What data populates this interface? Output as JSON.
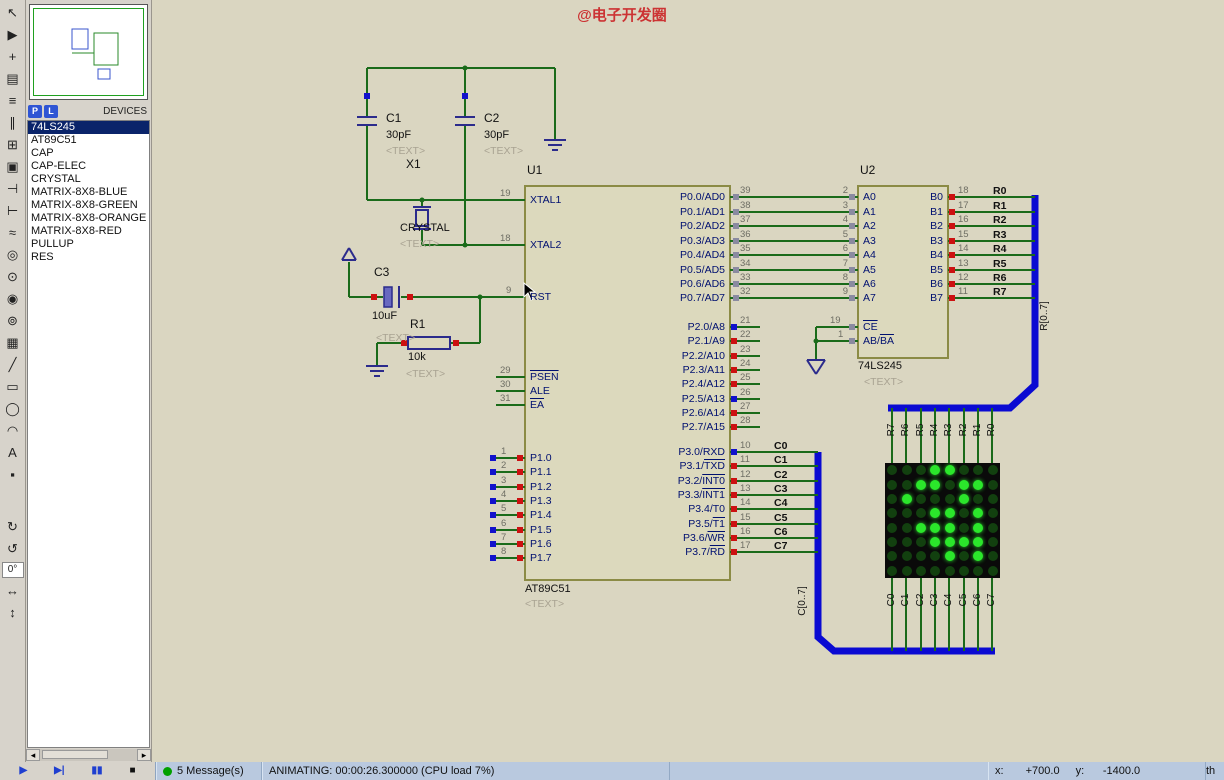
{
  "palette": {
    "canvas_bg": "#dad6c1",
    "wire": "#1a6b1a",
    "bus": "#0a0ad2",
    "chip_fill": "#dcd9bd",
    "chip_border": "#8b8b45",
    "symbol": "#2b2b8c",
    "pin_name": "#001070",
    "pin_num": "#6e6e64",
    "placeholder": "#a9a392",
    "title": "#cc3333",
    "indicator_high": "#cc1111",
    "indicator_low": "#1111cc",
    "indicator_float": "#8a8aa0",
    "matrix_bg": "#0a0a0a",
    "matrix_on": "#2be62b",
    "matrix_off": "#12400f",
    "selection_bg": "#0a246a"
  },
  "toolbar": {
    "icons": [
      {
        "name": "selection-tool",
        "glyph": "↖"
      },
      {
        "name": "component-mode",
        "glyph": "▶"
      },
      {
        "name": "junction-dot-mode",
        "glyph": "+"
      },
      {
        "name": "wire-label-mode",
        "glyph": "▤"
      },
      {
        "name": "text-script-mode",
        "glyph": "≡"
      },
      {
        "name": "buses-mode",
        "glyph": "∥"
      },
      {
        "name": "subcircuit-mode",
        "glyph": "⊞"
      },
      {
        "name": "instant-edit-mode",
        "glyph": "▣"
      },
      {
        "name": "inter-sheet-terminal-mode",
        "glyph": "⊣"
      },
      {
        "name": "device-pins-mode",
        "glyph": "⊢"
      },
      {
        "name": "graph-mode",
        "glyph": "≈"
      },
      {
        "name": "tape-recorder-mode",
        "glyph": "◎"
      },
      {
        "name": "generator-mode",
        "glyph": "⊙"
      },
      {
        "name": "voltage-probe-mode",
        "glyph": "◉"
      },
      {
        "name": "current-probe-mode",
        "glyph": "⊚"
      },
      {
        "name": "virtual-instruments-mode",
        "glyph": "▦"
      },
      {
        "name": "line-tool",
        "glyph": "╱"
      },
      {
        "name": "box-tool",
        "glyph": "▭"
      },
      {
        "name": "circle-tool",
        "glyph": "◯"
      },
      {
        "name": "arc-tool",
        "glyph": "◠"
      },
      {
        "name": "text-tool",
        "glyph": "A"
      },
      {
        "name": "symbol-tool",
        "glyph": "▪"
      },
      {
        "name": "spacer",
        "glyph": ""
      },
      {
        "name": "rotate-clockwise",
        "glyph": "↻"
      },
      {
        "name": "rotate-anticlockwise",
        "glyph": "↺"
      },
      {
        "name": "rotation-angle",
        "glyph": "0°"
      },
      {
        "name": "mirror-horizontal",
        "glyph": "↔"
      },
      {
        "name": "mirror-vertical",
        "glyph": "↕"
      }
    ]
  },
  "devices_panel": {
    "p_button": "P",
    "l_button": "L",
    "header": "DEVICES",
    "selected_index": 0,
    "items": [
      "74LS245",
      "AT89C51",
      "CAP",
      "CAP-ELEC",
      "CRYSTAL",
      "MATRIX-8X8-BLUE",
      "MATRIX-8X8-GREEN",
      "MATRIX-8X8-ORANGE",
      "MATRIX-8X8-RED",
      "PULLUP",
      "RES"
    ]
  },
  "schematic": {
    "title": "@电子开发圈",
    "components": {
      "u1": {
        "ref": "U1",
        "value": "AT89C51",
        "text": "<TEXT>"
      },
      "u2": {
        "ref": "U2",
        "value": "74LS245",
        "text": "<TEXT>"
      },
      "c1": {
        "ref": "C1",
        "value": "30pF",
        "text": "<TEXT>"
      },
      "c2": {
        "ref": "C2",
        "value": "30pF",
        "text": "<TEXT>"
      },
      "c3": {
        "ref": "C3",
        "value": "10uF",
        "text": "<TEXT>"
      },
      "r1": {
        "ref": "R1",
        "value": "10k",
        "text": "<TEXT>"
      },
      "x1": {
        "ref": "X1",
        "value": "CRYSTAL",
        "text": "<TEXT>"
      }
    },
    "u1_pins": {
      "misc": [
        {
          "num": "19",
          "segs": [
            {
              "t": "XTAL1"
            }
          ]
        },
        {
          "num": "18",
          "segs": [
            {
              "t": "XTAL2"
            }
          ]
        },
        {
          "num": "9",
          "segs": [
            {
              "t": "RST"
            }
          ]
        },
        {
          "num": "29",
          "segs": [
            {
              "t": "PSEN",
              "ov": true
            }
          ]
        },
        {
          "num": "30",
          "segs": [
            {
              "t": "ALE"
            }
          ]
        },
        {
          "num": "31",
          "segs": [
            {
              "t": "EA",
              "ov": true
            }
          ]
        }
      ],
      "p1": [
        {
          "num": "1",
          "segs": [
            {
              "t": "P1.0"
            }
          ]
        },
        {
          "num": "2",
          "segs": [
            {
              "t": "P1.1"
            }
          ]
        },
        {
          "num": "3",
          "segs": [
            {
              "t": "P1.2"
            }
          ]
        },
        {
          "num": "4",
          "segs": [
            {
              "t": "P1.3"
            }
          ]
        },
        {
          "num": "5",
          "segs": [
            {
              "t": "P1.4"
            }
          ]
        },
        {
          "num": "6",
          "segs": [
            {
              "t": "P1.5"
            }
          ]
        },
        {
          "num": "7",
          "segs": [
            {
              "t": "P1.6"
            }
          ]
        },
        {
          "num": "8",
          "segs": [
            {
              "t": "P1.7"
            }
          ]
        }
      ],
      "p0": [
        {
          "num": "39",
          "segs": [
            {
              "t": "P0.0/AD0"
            }
          ]
        },
        {
          "num": "38",
          "segs": [
            {
              "t": "P0.1/AD1"
            }
          ]
        },
        {
          "num": "37",
          "segs": [
            {
              "t": "P0.2/AD2"
            }
          ]
        },
        {
          "num": "36",
          "segs": [
            {
              "t": "P0.3/AD3"
            }
          ]
        },
        {
          "num": "35",
          "segs": [
            {
              "t": "P0.4/AD4"
            }
          ]
        },
        {
          "num": "34",
          "segs": [
            {
              "t": "P0.5/AD5"
            }
          ]
        },
        {
          "num": "33",
          "segs": [
            {
              "t": "P0.6/AD6"
            }
          ]
        },
        {
          "num": "32",
          "segs": [
            {
              "t": "P0.7/AD7"
            }
          ]
        }
      ],
      "p2": [
        {
          "num": "21",
          "segs": [
            {
              "t": "P2.0/A8"
            }
          ],
          "state": "low"
        },
        {
          "num": "22",
          "segs": [
            {
              "t": "P2.1/A9"
            }
          ],
          "state": "high"
        },
        {
          "num": "23",
          "segs": [
            {
              "t": "P2.2/A10"
            }
          ],
          "state": "high"
        },
        {
          "num": "24",
          "segs": [
            {
              "t": "P2.3/A11"
            }
          ],
          "state": "high"
        },
        {
          "num": "25",
          "segs": [
            {
              "t": "P2.4/A12"
            }
          ],
          "state": "high"
        },
        {
          "num": "26",
          "segs": [
            {
              "t": "P2.5/A13"
            }
          ],
          "state": "low"
        },
        {
          "num": "27",
          "segs": [
            {
              "t": "P2.6/A14"
            }
          ],
          "state": "high"
        },
        {
          "num": "28",
          "segs": [
            {
              "t": "P2.7/A15"
            }
          ],
          "state": "high"
        }
      ],
      "p3": [
        {
          "num": "10",
          "segs": [
            {
              "t": "P3.0/RXD"
            }
          ],
          "net": "C0",
          "state": "low"
        },
        {
          "num": "11",
          "segs": [
            {
              "t": "P3.1/"
            },
            {
              "t": "TXD",
              "ov": true
            }
          ],
          "net": "C1",
          "state": "high"
        },
        {
          "num": "12",
          "segs": [
            {
              "t": "P3.2/"
            },
            {
              "t": "INT0",
              "ov": true
            }
          ],
          "net": "C2",
          "state": "high"
        },
        {
          "num": "13",
          "segs": [
            {
              "t": "P3.3/"
            },
            {
              "t": "INT1",
              "ov": true
            }
          ],
          "net": "C3",
          "state": "high"
        },
        {
          "num": "14",
          "segs": [
            {
              "t": "P3.4/T0"
            }
          ],
          "net": "C4",
          "state": "high"
        },
        {
          "num": "15",
          "segs": [
            {
              "t": "P3.5/"
            },
            {
              "t": "T1",
              "ov": true
            }
          ],
          "net": "C5",
          "state": "high"
        },
        {
          "num": "16",
          "segs": [
            {
              "t": "P3.6/"
            },
            {
              "t": "WR",
              "ov": true
            }
          ],
          "net": "C6",
          "state": "high"
        },
        {
          "num": "17",
          "segs": [
            {
              "t": "P3.7/"
            },
            {
              "t": "RD",
              "ov": true
            }
          ],
          "net": "C7",
          "state": "high"
        }
      ]
    },
    "u2_pins": {
      "a": [
        {
          "num": "2",
          "segs": [
            {
              "t": "A0"
            }
          ]
        },
        {
          "num": "3",
          "segs": [
            {
              "t": "A1"
            }
          ]
        },
        {
          "num": "4",
          "segs": [
            {
              "t": "A2"
            }
          ]
        },
        {
          "num": "5",
          "segs": [
            {
              "t": "A3"
            }
          ]
        },
        {
          "num": "6",
          "segs": [
            {
              "t": "A4"
            }
          ]
        },
        {
          "num": "7",
          "segs": [
            {
              "t": "A5"
            }
          ]
        },
        {
          "num": "8",
          "segs": [
            {
              "t": "A6"
            }
          ]
        },
        {
          "num": "9",
          "segs": [
            {
              "t": "A7"
            }
          ]
        }
      ],
      "b": [
        {
          "num": "18",
          "segs": [
            {
              "t": "B0"
            }
          ],
          "net": "R0",
          "state": "high"
        },
        {
          "num": "17",
          "segs": [
            {
              "t": "B1"
            }
          ],
          "net": "R1",
          "state": "high"
        },
        {
          "num": "16",
          "segs": [
            {
              "t": "B2"
            }
          ],
          "net": "R2",
          "state": "high"
        },
        {
          "num": "15",
          "segs": [
            {
              "t": "B3"
            }
          ],
          "net": "R3",
          "state": "high"
        },
        {
          "num": "14",
          "segs": [
            {
              "t": "B4"
            }
          ],
          "net": "R4",
          "state": "high"
        },
        {
          "num": "13",
          "segs": [
            {
              "t": "B5"
            }
          ],
          "net": "R5",
          "state": "high"
        },
        {
          "num": "12",
          "segs": [
            {
              "t": "B6"
            }
          ],
          "net": "R6",
          "state": "high"
        },
        {
          "num": "11",
          "segs": [
            {
              "t": "B7"
            }
          ],
          "net": "R7",
          "state": "high"
        }
      ],
      "ctrl": [
        {
          "num": "19",
          "segs": [
            {
              "t": "CE",
              "ov": true
            }
          ]
        },
        {
          "num": "1",
          "segs": [
            {
              "t": "AB/"
            },
            {
              "t": "BA",
              "ov": true
            }
          ]
        }
      ]
    },
    "bus_labels": {
      "r": "R[0..7]",
      "c": "C[0..7]"
    },
    "matrix": {
      "top_labels": [
        "R7",
        "R6",
        "R5",
        "R4",
        "R3",
        "R2",
        "R1",
        "R0"
      ],
      "bottom_labels": [
        "C0",
        "C1",
        "C2",
        "C3",
        "C4",
        "C5",
        "C6",
        "C7"
      ],
      "pattern": [
        [
          0,
          0,
          0,
          1,
          1,
          0,
          0,
          0
        ],
        [
          0,
          0,
          1,
          1,
          0,
          1,
          1,
          0
        ],
        [
          0,
          1,
          0,
          0,
          0,
          1,
          0,
          0
        ],
        [
          0,
          0,
          0,
          1,
          1,
          0,
          1,
          0
        ],
        [
          0,
          0,
          1,
          1,
          1,
          0,
          1,
          0
        ],
        [
          0,
          0,
          0,
          1,
          1,
          1,
          1,
          0
        ],
        [
          0,
          0,
          0,
          0,
          1,
          0,
          1,
          0
        ],
        [
          0,
          0,
          0,
          0,
          0,
          0,
          0,
          0
        ]
      ]
    }
  },
  "status_bar": {
    "buttons": [
      {
        "name": "play-button",
        "glyph": "▶",
        "stop": false
      },
      {
        "name": "step-button",
        "glyph": "▶|",
        "stop": false
      },
      {
        "name": "pause-button",
        "glyph": "▮▮",
        "stop": false
      },
      {
        "name": "stop-button",
        "glyph": "■",
        "stop": true
      }
    ],
    "messages": "5 Message(s)",
    "animating": "ANIMATING: 00:00:26.300000 (CPU load 7%)",
    "x_label": "x:",
    "x_value": "+700.0",
    "y_label": "y:",
    "y_value": "-1400.0",
    "fragment": "th"
  }
}
